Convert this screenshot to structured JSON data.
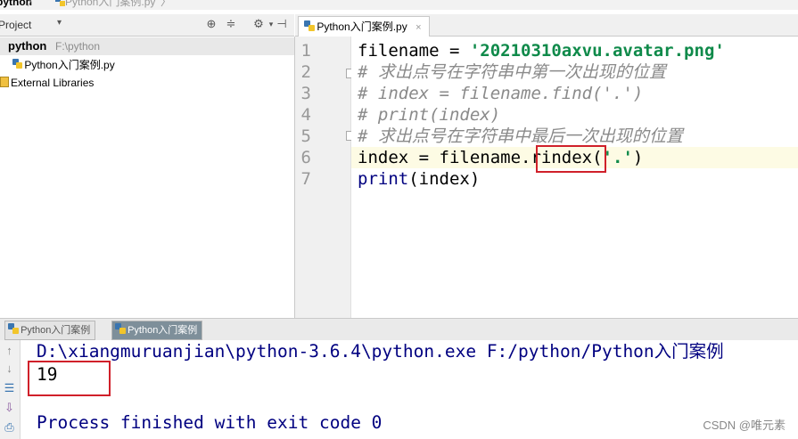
{
  "breadcrumb": {
    "root": "python",
    "sep": "〉",
    "file": "Python入门案例.py"
  },
  "project_panel": {
    "title": "Project",
    "dropdown": "▾",
    "toolbar_icons": [
      "target-icon",
      "collapse-icon",
      "gear-icon",
      "hide-icon"
    ],
    "tree": {
      "root_name": "python",
      "root_path": "F:\\python",
      "file": "Python入门案例.py",
      "external": "External Libraries"
    }
  },
  "editor": {
    "tab_label": "Python入门案例.py",
    "tab_close": "×",
    "line_numbers": [
      "1",
      "2",
      "3",
      "4",
      "5",
      "6",
      "7"
    ],
    "lines": {
      "l1_var": "filename = ",
      "l1_str": "'20210310axvu.avatar.png'",
      "l2": "# 求出点号在字符串中第一次出现的位置",
      "l3": "# index = filename.find('.')",
      "l4": "# print(index)",
      "l5": "# 求出点号在字符串中最后一次出现的位置",
      "l6_pre": "index = filename.",
      "l6_method": "rindex",
      "l6_open": "(",
      "l6_str": "'.'",
      "l6_close": ")",
      "l7_func": "print",
      "l7_args": "(index)"
    },
    "current_line": 6
  },
  "run_panel": {
    "tabs": [
      "Python入门案例",
      "Python入门案例"
    ],
    "active_tab": 1,
    "console": {
      "command": "D:\\xiangmuruanjian\\python-3.6.4\\python.exe F:/python/Python入门案例",
      "output": "19",
      "exit_message": "Process finished with exit code 0"
    }
  },
  "watermark": "CSDN @唯元素",
  "colors": {
    "string": "#0f8a4a",
    "comment": "#8a8a8a",
    "builtin": "#000080",
    "highlight_box": "#d0202a",
    "current_line": "#fdfbe4"
  }
}
